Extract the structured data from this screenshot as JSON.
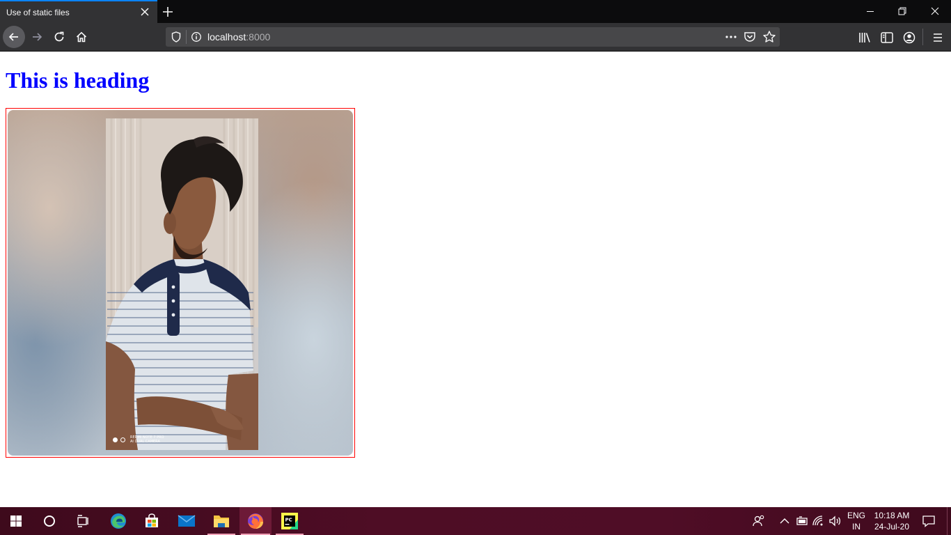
{
  "browser": {
    "tab_title": "Use of static files",
    "url_host": "localhost",
    "url_port": ":8000",
    "accent": "#0a84ff"
  },
  "page": {
    "heading": "This is heading",
    "heading_color": "#0000ff",
    "photo": {
      "border_color": "#ff0000",
      "watermark_line1": "REDMI NOTE 7 PRO",
      "watermark_line2": "AI DUAL CAMERA"
    }
  },
  "taskbar": {
    "apps": [
      "start-icon",
      "search-icon",
      "task-view-icon",
      "edge-icon",
      "store-icon",
      "mail-icon",
      "file-explorer-icon",
      "firefox-icon",
      "pycharm-icon"
    ],
    "pycharm_label": "PC",
    "lang_line1": "ENG",
    "lang_line2": "IN",
    "time": "10:18 AM",
    "date": "24-Jul-20"
  }
}
